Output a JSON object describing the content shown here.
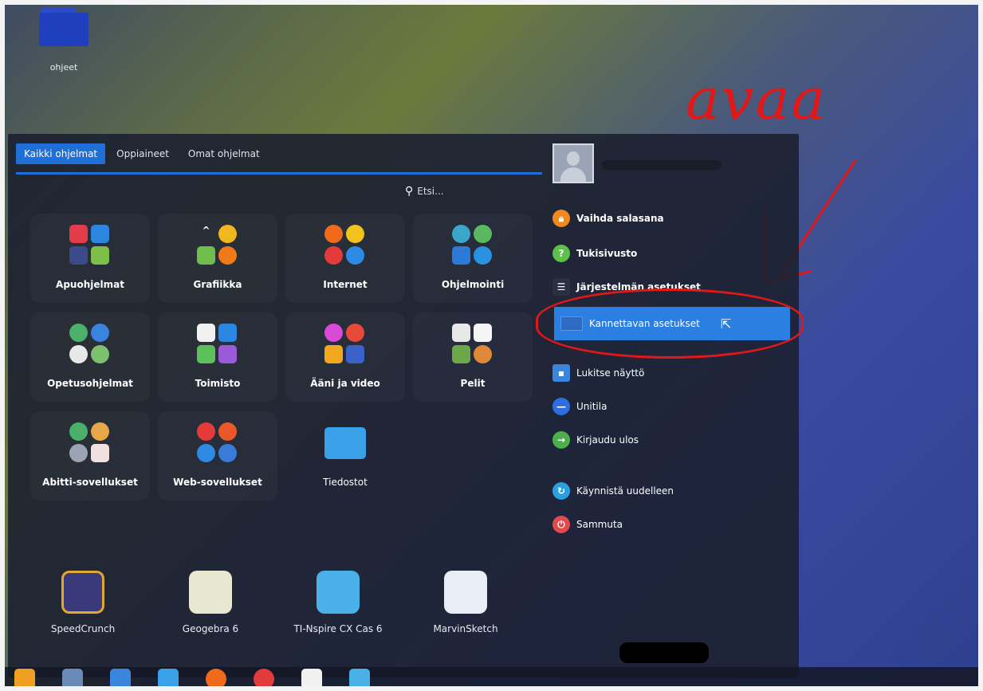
{
  "desktop": {
    "folder_label": "ohjeet"
  },
  "tabs": [
    {
      "label": "Kaikki ohjelmat"
    },
    {
      "label": "Oppiaineet"
    },
    {
      "label": "Omat ohjelmat"
    }
  ],
  "search": {
    "label": "Etsi..."
  },
  "categories": [
    {
      "label": "Apuohjelmat"
    },
    {
      "label": "Grafiikka"
    },
    {
      "label": "Internet"
    },
    {
      "label": "Ohjelmointi"
    },
    {
      "label": "Opetusohjelmat"
    },
    {
      "label": "Toimisto"
    },
    {
      "label": "Ääni ja video"
    },
    {
      "label": "Pelit"
    },
    {
      "label": "Abitti-sovellukset"
    },
    {
      "label": "Web-sovellukset"
    },
    {
      "label": "Tiedostot"
    }
  ],
  "pinned": [
    {
      "label": "SpeedCrunch"
    },
    {
      "label": "Geogebra 6"
    },
    {
      "label": "TI-Nspire CX Cas 6"
    },
    {
      "label": "MarvinSketch"
    }
  ],
  "actions": [
    {
      "label": "Vaihda salasana"
    },
    {
      "label": "Tukisivusto"
    },
    {
      "label": "Järjestelmän asetukset"
    },
    {
      "label": "Kannettavan asetukset"
    },
    {
      "label": "Lukitse näyttö"
    },
    {
      "label": "Unitila"
    },
    {
      "label": "Kirjaudu ulos"
    },
    {
      "label": "Käynnistä uudelleen"
    },
    {
      "label": "Sammuta"
    }
  ],
  "annotation": {
    "text": "avaa",
    "color": "#e01818"
  },
  "colors": {
    "accent": "#1e6fd8",
    "highlight": "#2a7fe0"
  }
}
